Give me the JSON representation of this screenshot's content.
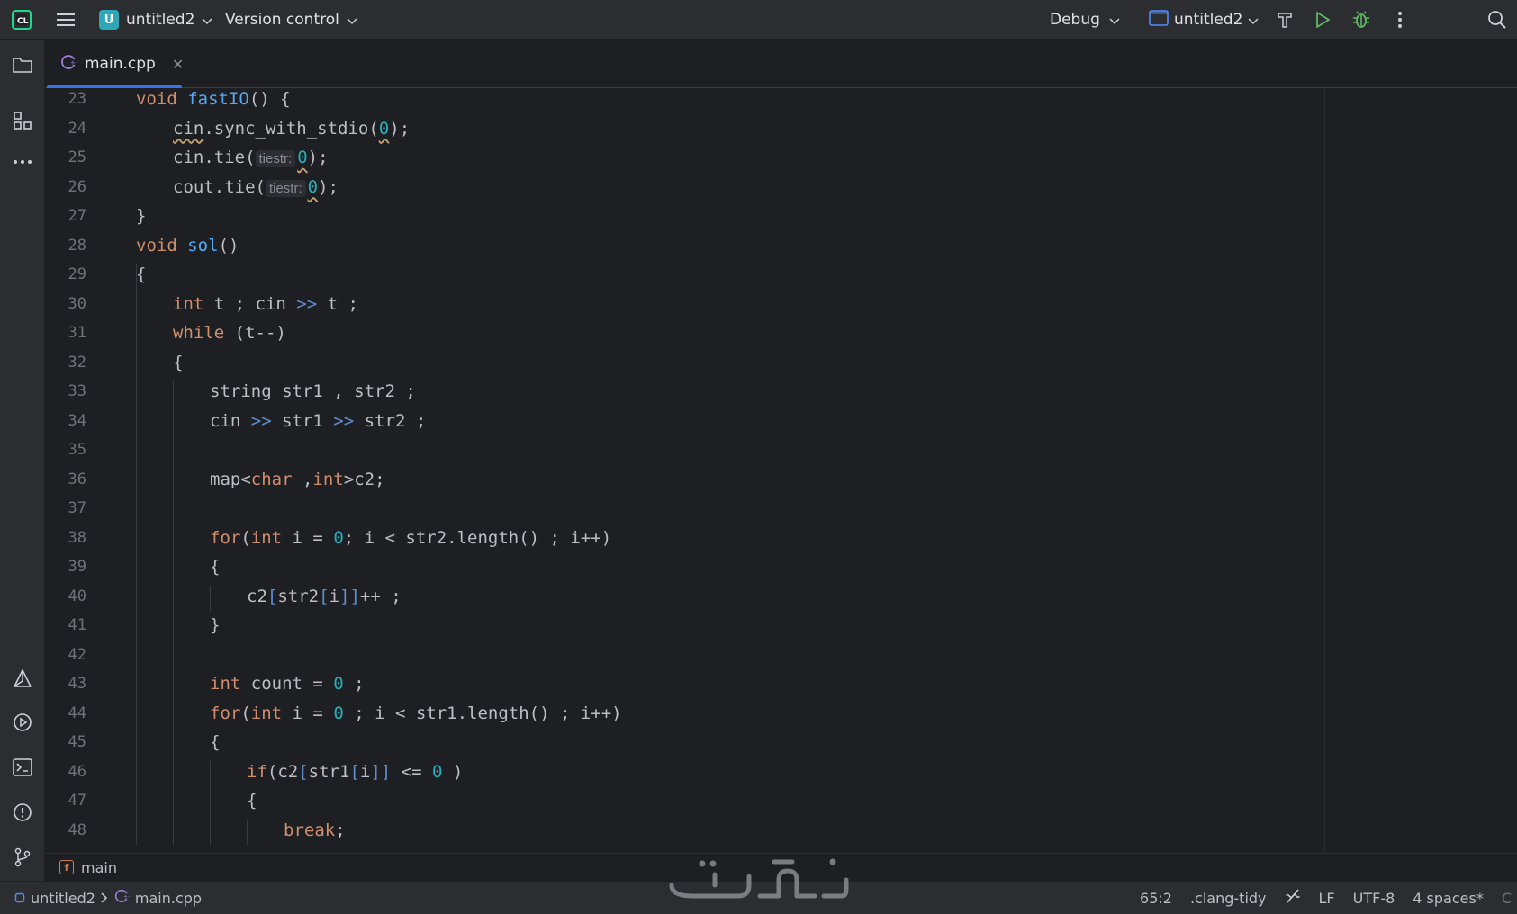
{
  "toolbar": {
    "logo_icon": "clion-logo-icon",
    "menu_icon": "hamburger-menu-icon",
    "project_badge": "U",
    "project_name": "untitled2",
    "vcs_label": "Version control",
    "run_config_mode": "Debug",
    "run_config_target": "untitled2",
    "build_icon": "hammer-icon",
    "run_icon": "run-icon",
    "debug_icon": "bug-icon",
    "more_icon": "kebab-icon",
    "search_icon": "search-icon"
  },
  "left_strip": {
    "items": [
      "folder-icon",
      "structure-icon",
      "more-horizontal-icon",
      "cmake-icon",
      "services-icon",
      "terminal-icon",
      "problems-icon",
      "git-branch-icon"
    ]
  },
  "tabs": [
    {
      "label": "main.cpp",
      "active": true,
      "icon": "cpp-file-icon"
    }
  ],
  "editor": {
    "lines": [
      {
        "n": "23",
        "indent": 0,
        "tokens": [
          [
            "kw",
            "void"
          ],
          [
            "tx",
            " "
          ],
          [
            "fn",
            "fastIO"
          ],
          [
            "tx",
            "() {"
          ]
        ]
      },
      {
        "n": "24",
        "indent": 1,
        "tokens": [
          [
            "sq",
            "cin"
          ],
          [
            "tx",
            ".sync_with_stdio("
          ],
          [
            "sqnum",
            "0"
          ],
          [
            "tx",
            ");"
          ]
        ]
      },
      {
        "n": "25",
        "indent": 1,
        "tokens": [
          [
            "tx",
            "cin.tie("
          ],
          [
            "hint",
            "tiestr:"
          ],
          [
            "sqnum",
            "0"
          ],
          [
            "tx",
            ");"
          ]
        ]
      },
      {
        "n": "26",
        "indent": 1,
        "tokens": [
          [
            "tx",
            "cout.tie("
          ],
          [
            "hint",
            "tiestr:"
          ],
          [
            "sqnum",
            "0"
          ],
          [
            "tx",
            ");"
          ]
        ]
      },
      {
        "n": "27",
        "indent": 0,
        "tokens": [
          [
            "tx",
            "}"
          ]
        ]
      },
      {
        "n": "28",
        "indent": 0,
        "tokens": [
          [
            "kw",
            "void"
          ],
          [
            "tx",
            " "
          ],
          [
            "fn",
            "sol"
          ],
          [
            "tx",
            "()"
          ]
        ]
      },
      {
        "n": "29",
        "indent": 0,
        "tokens": [
          [
            "tx",
            "{"
          ]
        ]
      },
      {
        "n": "30",
        "indent": 1,
        "tokens": [
          [
            "kw",
            "int"
          ],
          [
            "tx",
            " t ; cin "
          ],
          [
            "op",
            ">>"
          ],
          [
            "tx",
            " t ;"
          ]
        ]
      },
      {
        "n": "31",
        "indent": 1,
        "tokens": [
          [
            "kw",
            "while"
          ],
          [
            "tx",
            " (t--)"
          ]
        ]
      },
      {
        "n": "32",
        "indent": 1,
        "tokens": [
          [
            "tx",
            "{"
          ]
        ]
      },
      {
        "n": "33",
        "indent": 2,
        "tokens": [
          [
            "tx",
            "string str1 , str2 ;"
          ]
        ]
      },
      {
        "n": "34",
        "indent": 2,
        "tokens": [
          [
            "tx",
            "cin "
          ],
          [
            "op",
            ">>"
          ],
          [
            "tx",
            " str1 "
          ],
          [
            "op",
            ">>"
          ],
          [
            "tx",
            " str2 ;"
          ]
        ]
      },
      {
        "n": "35",
        "indent": 2,
        "tokens": []
      },
      {
        "n": "36",
        "indent": 2,
        "tokens": [
          [
            "tx",
            "map<"
          ],
          [
            "kw",
            "char"
          ],
          [
            "tx",
            " ,"
          ],
          [
            "kw",
            "int"
          ],
          [
            "tx",
            ">c2;"
          ]
        ]
      },
      {
        "n": "37",
        "indent": 2,
        "tokens": []
      },
      {
        "n": "38",
        "indent": 2,
        "tokens": [
          [
            "kw",
            "for"
          ],
          [
            "tx",
            "("
          ],
          [
            "kw",
            "int"
          ],
          [
            "tx",
            " i = "
          ],
          [
            "num",
            "0"
          ],
          [
            "tx",
            "; i < str2.length() ; i++)"
          ]
        ]
      },
      {
        "n": "39",
        "indent": 2,
        "tokens": [
          [
            "tx",
            "{"
          ]
        ]
      },
      {
        "n": "40",
        "indent": 3,
        "tokens": [
          [
            "tx",
            "c2"
          ],
          [
            "op",
            "["
          ],
          [
            "tx",
            "str2"
          ],
          [
            "op",
            "["
          ],
          [
            "tx",
            "i"
          ],
          [
            "op",
            "]]"
          ],
          [
            "tx",
            "++ ;"
          ]
        ]
      },
      {
        "n": "41",
        "indent": 2,
        "tokens": [
          [
            "tx",
            "}"
          ]
        ]
      },
      {
        "n": "42",
        "indent": 2,
        "tokens": []
      },
      {
        "n": "43",
        "indent": 2,
        "tokens": [
          [
            "kw",
            "int"
          ],
          [
            "tx",
            " count = "
          ],
          [
            "num",
            "0"
          ],
          [
            "tx",
            " ;"
          ]
        ]
      },
      {
        "n": "44",
        "indent": 2,
        "tokens": [
          [
            "kw",
            "for"
          ],
          [
            "tx",
            "("
          ],
          [
            "kw",
            "int"
          ],
          [
            "tx",
            " i = "
          ],
          [
            "num",
            "0"
          ],
          [
            "tx",
            " ; i < str1.length() ; i++)"
          ]
        ]
      },
      {
        "n": "45",
        "indent": 2,
        "tokens": [
          [
            "tx",
            "{"
          ]
        ]
      },
      {
        "n": "46",
        "indent": 3,
        "tokens": [
          [
            "kw",
            "if"
          ],
          [
            "tx",
            "(c2"
          ],
          [
            "op",
            "["
          ],
          [
            "tx",
            "str1"
          ],
          [
            "op",
            "["
          ],
          [
            "tx",
            "i"
          ],
          [
            "op",
            "]]"
          ],
          [
            "tx",
            " <= "
          ],
          [
            "num",
            "0"
          ],
          [
            "tx",
            " )"
          ]
        ]
      },
      {
        "n": "47",
        "indent": 3,
        "tokens": [
          [
            "tx",
            "{"
          ]
        ]
      },
      {
        "n": "48",
        "indent": 4,
        "tokens": [
          [
            "kw",
            "break"
          ],
          [
            "tx",
            ";"
          ]
        ]
      }
    ]
  },
  "breadcrumb": {
    "function_badge": "f",
    "label": "main"
  },
  "statusbar": {
    "project": "untitled2",
    "file": "main.cpp",
    "position": "65:2",
    "linter": ".clang-tidy",
    "line_ending": "LF",
    "encoding": "UTF-8",
    "indent": "4 spaces*",
    "overflow": "C"
  },
  "colors": {
    "background": "#1e1f22",
    "chrome": "#2b2d30",
    "accent": "#3574f0",
    "keyword": "#cf8e6d",
    "function": "#56a8f5",
    "number": "#2aacb8"
  }
}
